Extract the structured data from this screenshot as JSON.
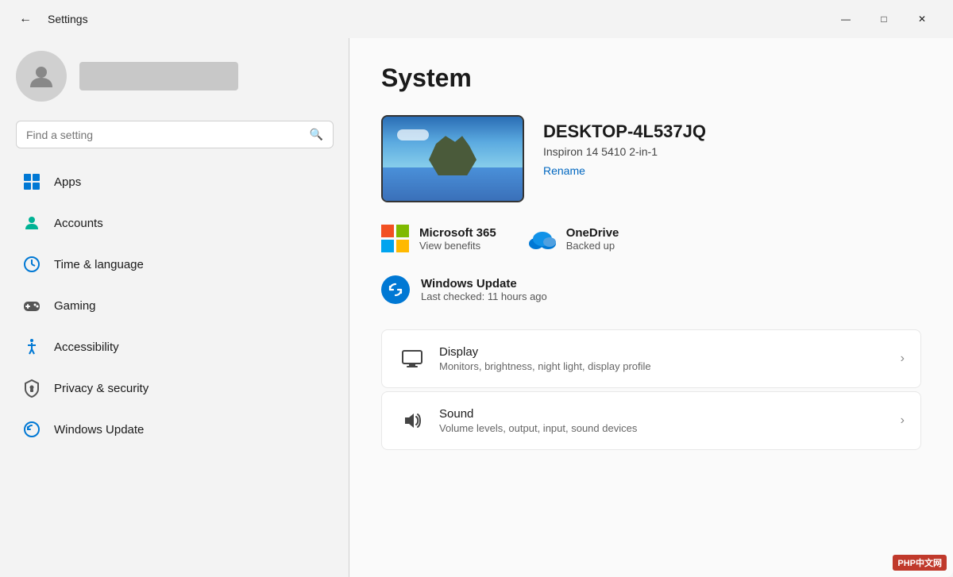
{
  "window": {
    "title": "Settings",
    "back_button": "←",
    "controls": {
      "minimize": "—",
      "maximize": "□",
      "close": "✕"
    }
  },
  "sidebar": {
    "search": {
      "placeholder": "Find a setting",
      "value": ""
    },
    "nav_items": [
      {
        "id": "apps",
        "label": "Apps",
        "icon": "apps-icon"
      },
      {
        "id": "accounts",
        "label": "Accounts",
        "icon": "accounts-icon"
      },
      {
        "id": "time-language",
        "label": "Time & language",
        "icon": "time-icon"
      },
      {
        "id": "gaming",
        "label": "Gaming",
        "icon": "gaming-icon"
      },
      {
        "id": "accessibility",
        "label": "Accessibility",
        "icon": "accessibility-icon"
      },
      {
        "id": "privacy-security",
        "label": "Privacy & security",
        "icon": "privacy-icon"
      },
      {
        "id": "windows-update",
        "label": "Windows Update",
        "icon": "update-nav-icon"
      }
    ]
  },
  "main": {
    "title": "System",
    "pc": {
      "name": "DESKTOP-4L537JQ",
      "model": "Inspiron 14 5410 2-in-1",
      "rename_label": "Rename"
    },
    "services": [
      {
        "id": "microsoft365",
        "name": "Microsoft 365",
        "sub": "View benefits"
      },
      {
        "id": "onedrive",
        "name": "OneDrive",
        "sub": "Backed up"
      }
    ],
    "windows_update": {
      "name": "Windows Update",
      "sub": "Last checked: 11 hours ago"
    },
    "settings_items": [
      {
        "id": "display",
        "name": "Display",
        "desc": "Monitors, brightness, night light, display profile",
        "icon": "display-icon"
      },
      {
        "id": "sound",
        "name": "Sound",
        "desc": "Volume levels, output, input, sound devices",
        "icon": "sound-icon"
      }
    ]
  },
  "watermark": "PHP中文网"
}
